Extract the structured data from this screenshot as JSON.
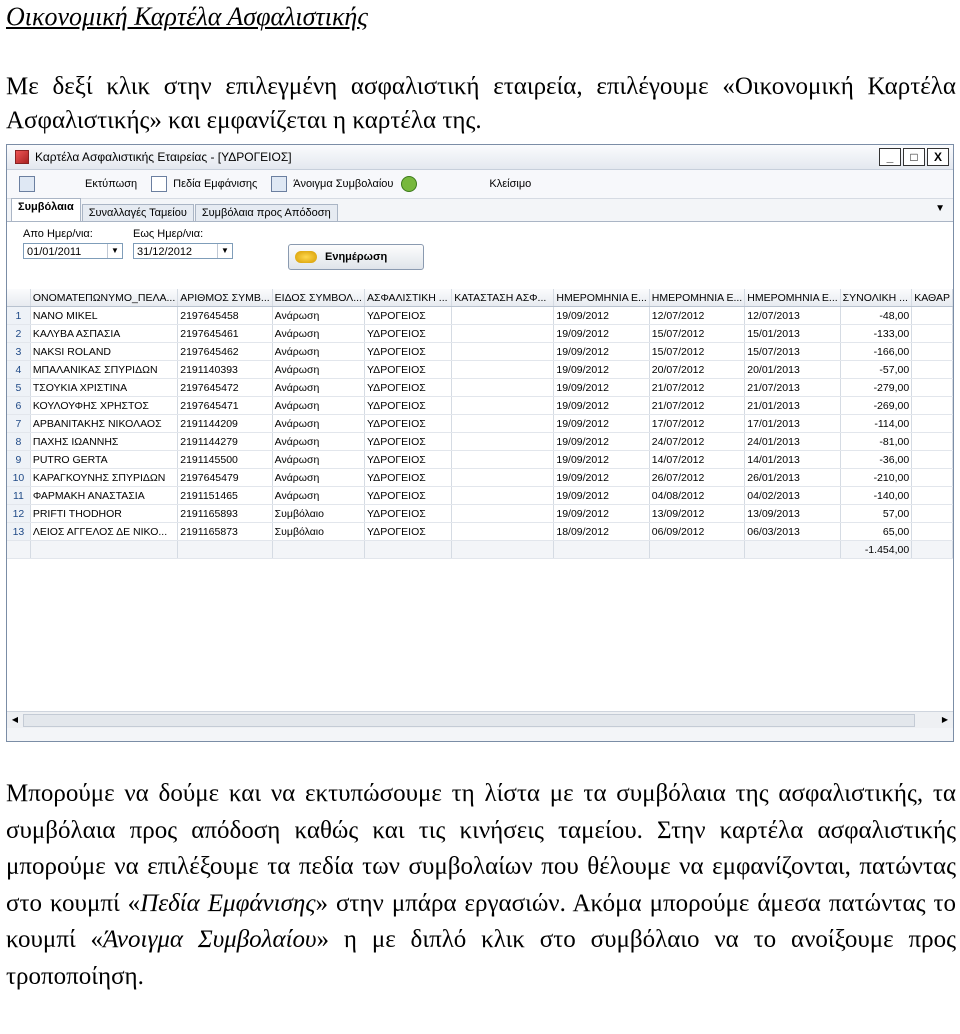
{
  "heading": "Οικονομική Καρτέλα Ασφαλιστικής",
  "intro": "Με δεξί κλικ στην επιλεγμένη ασφαλιστική εταιρεία, επιλέγουμε «Οικονομική Καρτέλα Ασφαλιστικής» και εμφανίζεται η καρτέλα της.",
  "window": {
    "title": "Καρτέλα Ασφαλιστικής Εταιρείας - [ΥΔΡΟΓΕΙΟΣ]",
    "btn_min": "_",
    "btn_max": "□",
    "btn_close": "X",
    "toolbar": {
      "print": "Εκτύπωση",
      "fields": "Πεδία Εμφάνισης",
      "open": "Άνοιγμα Συμβολαίου",
      "close": "Κλείσιμο"
    },
    "tabs": [
      "Συμβόλαια",
      "Συναλλαγές Ταμείου",
      "Συμβόλαια προς Απόδοση"
    ],
    "from_label": "Απο Ημερ/νια:",
    "from_value": "01/01/2011",
    "to_label": "Εως Ημερ/νια:",
    "to_value": "31/12/2012",
    "update_label": "Ενημέρωση",
    "columns": [
      "ΟΝΟΜΑΤΕΠΩΝΥΜΟ_ΠΕΛΑ...",
      "ΑΡΙΘΜΟΣ ΣΥΜΒ...",
      "ΕΙΔΟΣ ΣΥΜΒΟΛ...",
      "ΑΣΦΑΛΙΣΤΙΚΗ ...",
      "ΚΑΤΑΣΤΑΣΗ ΑΣΦ...",
      "ΗΜΕΡΟΜΗΝΙΑ Ε...",
      "ΗΜΕΡΟΜΗΝΙΑ Ε...",
      "ΗΜΕΡΟΜΗΝΙΑ Ε...",
      "ΣΥΝΟΛΙΚΗ ...",
      "ΚΑΘΑΡ"
    ],
    "rows": [
      [
        "1",
        "NANO MIKEL",
        "2197645458",
        "Ανάρωση",
        "ΥΔΡΟΓΕΙΟΣ",
        "",
        "19/09/2012",
        "12/07/2012",
        "12/07/2013",
        "-48,00"
      ],
      [
        "2",
        "ΚΑΛΥΒΑ ΑΣΠΑΣΙΑ",
        "2197645461",
        "Ανάρωση",
        "ΥΔΡΟΓΕΙΟΣ",
        "",
        "19/09/2012",
        "15/07/2012",
        "15/01/2013",
        "-133,00"
      ],
      [
        "3",
        "NAKSI ROLAND",
        "2197645462",
        "Ανάρωση",
        "ΥΔΡΟΓΕΙΟΣ",
        "",
        "19/09/2012",
        "15/07/2012",
        "15/07/2013",
        "-166,00"
      ],
      [
        "4",
        "ΜΠΑΛΑΝΙΚΑΣ ΣΠΥΡΙΔΩΝ",
        "2191140393",
        "Ανάρωση",
        "ΥΔΡΟΓΕΙΟΣ",
        "",
        "19/09/2012",
        "20/07/2012",
        "20/01/2013",
        "-57,00"
      ],
      [
        "5",
        "ΤΣΟΥΚΙΑ ΧΡΙΣΤΙΝΑ",
        "2197645472",
        "Ανάρωση",
        "ΥΔΡΟΓΕΙΟΣ",
        "",
        "19/09/2012",
        "21/07/2012",
        "21/07/2013",
        "-279,00"
      ],
      [
        "6",
        "ΚΟΥΛΟΥΦΗΣ ΧΡΗΣΤΟΣ",
        "2197645471",
        "Ανάρωση",
        "ΥΔΡΟΓΕΙΟΣ",
        "",
        "19/09/2012",
        "21/07/2012",
        "21/01/2013",
        "-269,00"
      ],
      [
        "7",
        "ΑΡΒΑΝΙΤΑΚΗΣ ΝΙΚΟΛΑΟΣ",
        "2191144209",
        "Ανάρωση",
        "ΥΔΡΟΓΕΙΟΣ",
        "",
        "19/09/2012",
        "17/07/2012",
        "17/01/2013",
        "-114,00"
      ],
      [
        "8",
        "ΠΑΧΗΣ ΙΩΑΝΝΗΣ",
        "2191144279",
        "Ανάρωση",
        "ΥΔΡΟΓΕΙΟΣ",
        "",
        "19/09/2012",
        "24/07/2012",
        "24/01/2013",
        "-81,00"
      ],
      [
        "9",
        "PUTRO GERTA",
        "2191145500",
        "Ανάρωση",
        "ΥΔΡΟΓΕΙΟΣ",
        "",
        "19/09/2012",
        "14/07/2012",
        "14/01/2013",
        "-36,00"
      ],
      [
        "10",
        "ΚΑΡΑΓΚΟΥΝΗΣ ΣΠΥΡΙΔΩΝ",
        "2197645479",
        "Ανάρωση",
        "ΥΔΡΟΓΕΙΟΣ",
        "",
        "19/09/2012",
        "26/07/2012",
        "26/01/2013",
        "-210,00"
      ],
      [
        "11",
        "ΦΑΡΜΑΚΗ ΑΝΑΣΤΑΣΙΑ",
        "2191151465",
        "Ανάρωση",
        "ΥΔΡΟΓΕΙΟΣ",
        "",
        "19/09/2012",
        "04/08/2012",
        "04/02/2013",
        "-140,00"
      ],
      [
        "12",
        "PRIFTI THODHOR",
        "2191165893",
        "Συμβόλαιο",
        "ΥΔΡΟΓΕΙΟΣ",
        "",
        "19/09/2012",
        "13/09/2012",
        "13/09/2013",
        "57,00"
      ],
      [
        "13",
        "ΛΕΙΟΣ ΑΓΓΕΛΟΣ ΔΕ ΝΙΚΟ...",
        "2191165873",
        "Συμβόλαιο",
        "ΥΔΡΟΓΕΙΟΣ",
        "",
        "18/09/2012",
        "06/09/2012",
        "06/03/2013",
        "65,00"
      ]
    ],
    "total": "-1.454,00"
  },
  "body_parts": [
    "Μπορούμε να δούμε και να εκτυπώσουμε τη λίστα με τα συμβόλαια της ασφαλιστικής, τα συμβόλαια προς απόδοση καθώς και τις κινήσεις ταμείου. Στην καρτέλα ασφαλιστικής μπορούμε να επιλέξουμε τα πεδία των συμβολαίων που θέλουμε να εμφανίζονται, πατώντας στο κουμπί «",
    "Πεδία Εμφάνισης",
    "» στην μπάρα εργασιών. Ακόμα μπορούμε άμεσα πατώντας το κουμπί «",
    "Άνοιγμα Συμβολαίου",
    "» η με διπλό κλικ στο συμβόλαιο να το ανοίξουμε προς τροποποίηση."
  ]
}
